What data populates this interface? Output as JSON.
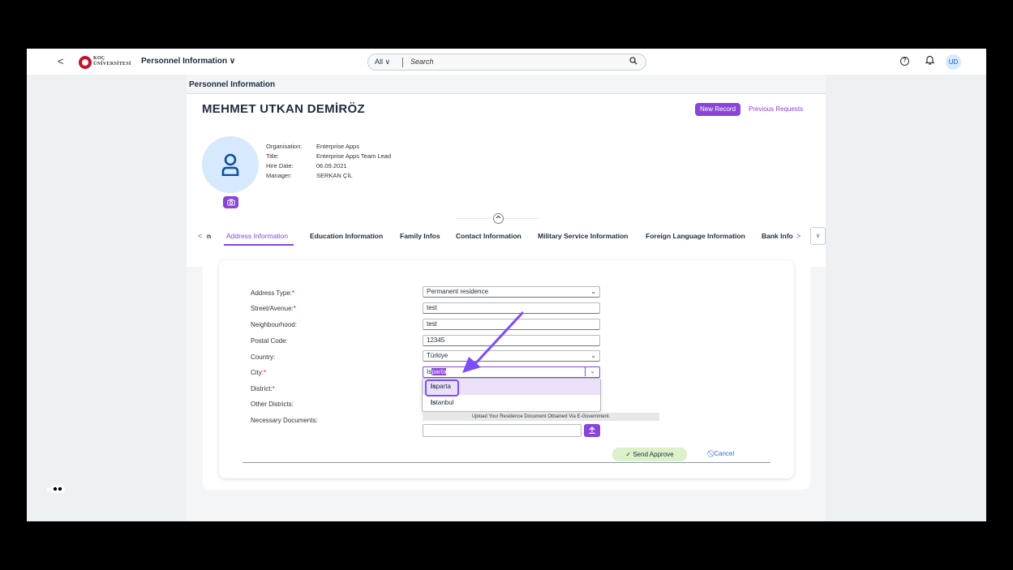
{
  "shell": {
    "back": "<",
    "logo_line1": "KOÇ",
    "logo_line2": "ÜNİVERSİTESİ",
    "title": "Personnel Information",
    "title_chevron": "∨",
    "search_scope": "All  ∨",
    "search_placeholder": "Search",
    "user_initials": "UD"
  },
  "page": {
    "title": "Personnel Information",
    "employee_name": "MEHMET UTKAN DEMİRÖZ",
    "new_record": "New Record",
    "previous_requests": "Previous Requests",
    "info": [
      {
        "label": "Organisation:",
        "value": "Enterprise Apps"
      },
      {
        "label": "Title:",
        "value": "Enterprise Apps Team Lead"
      },
      {
        "label": "Hire Date:",
        "value": "06.09.2021"
      },
      {
        "label": "Manager:",
        "value": "SERKAN ÇİL"
      }
    ]
  },
  "tabs": {
    "prev_partial": "n",
    "items": [
      "Address Information",
      "Education Information",
      "Family Infos",
      "Contact Information",
      "Military Service Information",
      "Foreign Language Information",
      "Bank Info"
    ],
    "active": "Address Information"
  },
  "form": {
    "labels": {
      "address_type": "Address Type:",
      "street": "Street/Avenue:",
      "neighbourhood": "Neighbourhood:",
      "postal": "Postal Code:",
      "country": "Country:",
      "city": "City:",
      "district": "District:",
      "other_districts": "Other Districts:",
      "documents": "Necessary Documents:"
    },
    "required_mark": "*",
    "values": {
      "address_type": "Permanent residence",
      "street": "test",
      "neighbourhood": "test",
      "postal": "12345",
      "country": "Türkiye",
      "city_typed": "Is",
      "city_autocomplete": "parta"
    },
    "city_options": [
      {
        "match": "Is",
        "rest": "parta"
      },
      {
        "match": "Is",
        "rest": "tanbul"
      }
    ],
    "upload_note": "Upload Your Residence Document Obtained Via E-Government.",
    "send_approve": "Send Approve",
    "cancel": "Cancel"
  },
  "colors": {
    "accent": "#8a45d8",
    "highlight_ring": "#7c4dff",
    "send_bg": "#daf1c9",
    "cancel_link": "#2a6fd8"
  }
}
